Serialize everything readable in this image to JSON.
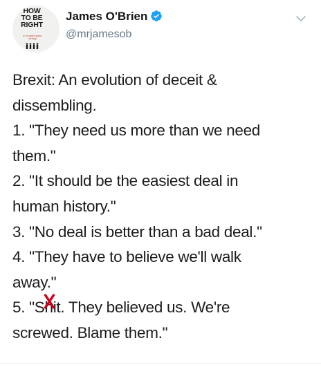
{
  "author": {
    "display_name": "James O'Brien",
    "handle": "@mrjamesob",
    "verified": true,
    "avatar": {
      "book_title_lines": [
        "HOW",
        "TO BE",
        "RIGHT"
      ],
      "book_subtitle": "in a world gone wrong"
    }
  },
  "icons": {
    "verified": "verified-badge-icon",
    "more": "chevron-down-icon"
  },
  "colors": {
    "verified_blue": "#1da1f2",
    "handle_gray": "#657786",
    "text": "#1c1c1c",
    "strike_red": "#d0021b"
  },
  "tweet": {
    "lines": [
      "Brexit: An evolution of deceit &",
      "dissembling.",
      "1. \"They need us more than we need",
      "them.\"",
      "2. \"It should be the easiest deal in",
      "human history.\"",
      "3. \"No deal is better than a bad deal.\"",
      "4. \"They have to believe we'll walk",
      "away.\""
    ],
    "line_10_prefix": "5. \"S",
    "line_10_struck": "h",
    "line_10_suffix": "it. They believed us. We're",
    "line_11": "screwed. Blame them.\""
  }
}
